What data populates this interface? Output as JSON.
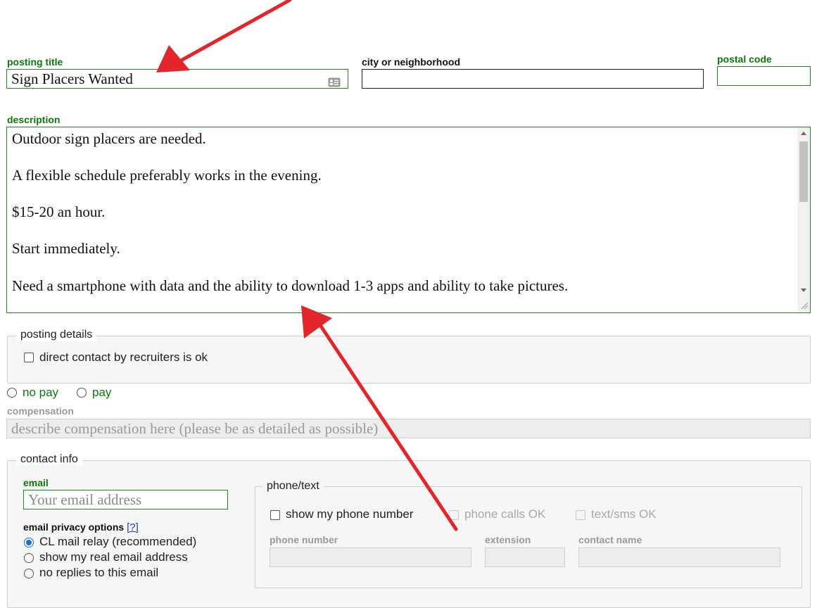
{
  "form": {
    "posting_title": {
      "label": "posting title",
      "value": "Sign Placers Wanted"
    },
    "city": {
      "label": "city or neighborhood",
      "value": ""
    },
    "postal_code": {
      "label": "postal code",
      "value": ""
    },
    "description": {
      "label": "description",
      "lines": [
        "Outdoor sign placers are needed.",
        "A flexible schedule preferably works in the evening.",
        "$15-20 an hour.",
        "Start immediately.",
        "Need a smartphone with data and the ability to download 1-3 apps and ability to take pictures."
      ]
    },
    "posting_details": {
      "legend": "posting details",
      "recruiters_label": "direct contact by recruiters is ok"
    },
    "pay": {
      "no_pay": "no pay",
      "pay": "pay"
    },
    "compensation": {
      "label": "compensation",
      "placeholder": "describe compensation here (please be as detailed as possible)"
    },
    "contact_info": {
      "legend": "contact info",
      "email_label": "email",
      "email_placeholder": "Your email address",
      "privacy_label": "email privacy options",
      "privacy_help": "[?]",
      "privacy_options": [
        "CL mail relay (recommended)",
        "show my real email address",
        "no replies to this email"
      ],
      "phone": {
        "legend": "phone/text",
        "show_phone": "show my phone number",
        "calls_ok": "phone calls OK",
        "text_ok": "text/sms OK",
        "phone_number_label": "phone number",
        "extension_label": "extension",
        "contact_name_label": "contact name"
      }
    }
  },
  "colors": {
    "accent_green": "#0a7a0a",
    "arrow_red": "#e3262b",
    "link_blue": "#1a3fc4"
  }
}
